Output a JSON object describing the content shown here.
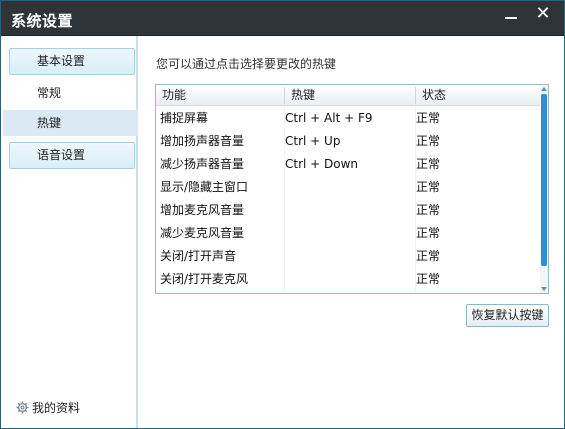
{
  "window": {
    "title": "系统设置"
  },
  "sidebar": {
    "groups": [
      {
        "label": "基本设置"
      },
      {
        "label": "语音设置"
      }
    ],
    "items": [
      {
        "label": "常规"
      },
      {
        "label": "热键"
      }
    ],
    "footer": {
      "label": "我的资料",
      "icon": "gear-icon"
    }
  },
  "main": {
    "hint": "您可以通过点击选择要更改的热键",
    "table": {
      "headers": [
        "功能",
        "热键",
        "状态"
      ],
      "rows": [
        [
          "捕捉屏幕",
          "Ctrl + Alt + F9",
          "正常"
        ],
        [
          "增加扬声器音量",
          "Ctrl + Up",
          "正常"
        ],
        [
          "减少扬声器音量",
          "Ctrl + Down",
          "正常"
        ],
        [
          "显示/隐藏主窗口",
          "",
          "正常"
        ],
        [
          "增加麦克风音量",
          "",
          "正常"
        ],
        [
          "减少麦克风音量",
          "",
          "正常"
        ],
        [
          "关闭/打开声音",
          "",
          "正常"
        ],
        [
          "关闭/打开麦克风",
          "",
          "正常"
        ]
      ]
    },
    "restore_button": "恢复默认按键"
  }
}
